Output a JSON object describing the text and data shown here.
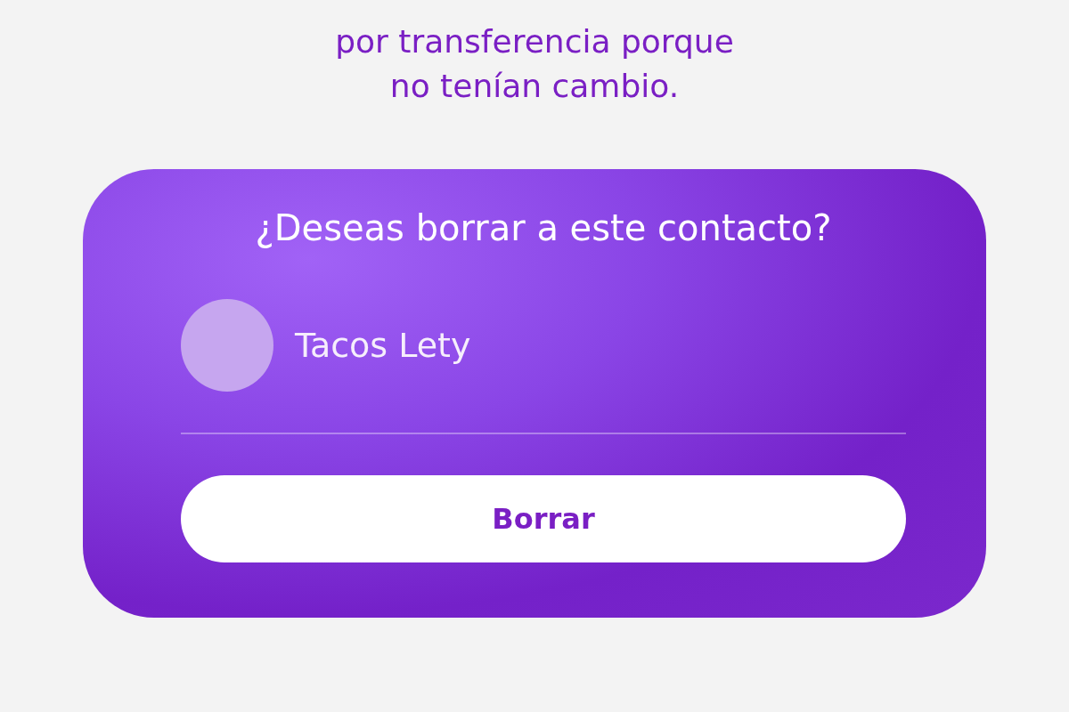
{
  "message": {
    "lines": [
      "por transferencia porque",
      "no tenían cambio."
    ]
  },
  "dialog": {
    "title": "¿Deseas borrar a este contacto?",
    "contact": {
      "name": "Tacos Lety"
    },
    "button": "Borrar"
  }
}
